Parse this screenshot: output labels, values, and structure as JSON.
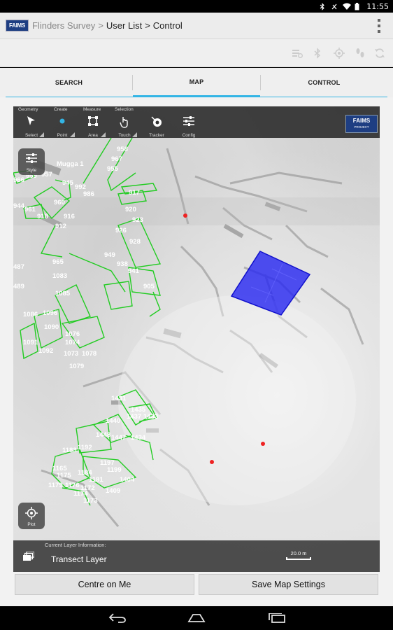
{
  "status_bar": {
    "icons": [
      "bluetooth-icon",
      "signal-off-icon",
      "wifi-icon",
      "battery-icon"
    ],
    "time": "11:55"
  },
  "action_bar": {
    "logo_text": "FAIMS",
    "breadcrumb": [
      "Flinders Survey",
      ">",
      "User List",
      ">",
      "Control"
    ],
    "overflow_icon": "overflow-menu-icon"
  },
  "tool_row": {
    "icons": [
      "sync-status-icon",
      "bluetooth-icon",
      "gps-icon",
      "tracker-icon",
      "sync-icon"
    ]
  },
  "tabs": [
    {
      "label": "SEARCH",
      "active": false
    },
    {
      "label": "MAP",
      "active": true
    },
    {
      "label": "CONTROL",
      "active": false
    }
  ],
  "map": {
    "toolbar": {
      "groups": [
        "Geometry",
        "Create",
        "Measure",
        "Selection"
      ],
      "buttons": [
        {
          "label": "Select",
          "icon": "cursor-icon"
        },
        {
          "label": "Point",
          "icon": "point-icon"
        },
        {
          "label": "Area",
          "icon": "polygon-icon"
        },
        {
          "label": "Touch",
          "icon": "touch-icon"
        },
        {
          "label": "Tracker",
          "icon": "tracker-icon"
        },
        {
          "label": "Config",
          "icon": "sliders-icon"
        }
      ],
      "badge": {
        "title": "FAIMS",
        "subtitle": "PROJECT"
      }
    },
    "style_button": {
      "label": "Style",
      "icon": "sliders-icon"
    },
    "plot_button": {
      "label": "Plot",
      "icon": "crosshair-icon"
    },
    "site_label": "Mugga 1",
    "feature_labels": [
      "958",
      "967",
      "955",
      "966",
      "959",
      "957",
      "945",
      "992",
      "986",
      "944",
      "961",
      "960",
      "918",
      "916",
      "912",
      "917",
      "920",
      "923",
      "926",
      "928",
      "949",
      "965",
      "938",
      "941",
      "905",
      "487",
      "489",
      "1083",
      "1085",
      "1086",
      "1096",
      "1090",
      "1091",
      "1092",
      "1076",
      "1074",
      "1073",
      "1078",
      "1079",
      "1431",
      "1435",
      "1437",
      "1433",
      "1440",
      "1448",
      "1447",
      "1434",
      "1197",
      "1199",
      "1183",
      "1192",
      "1404",
      "1409",
      "1172",
      "1173",
      "1175",
      "1179",
      "1184",
      "1181",
      "1174",
      "1165",
      "1176"
    ],
    "layer_bar": {
      "info_label": "Current Layer Information:",
      "layer_name": "Transect Layer",
      "scale_label": "20.0 m"
    },
    "selection_color": "#2222ff",
    "feature_color": "#22cc22",
    "point_color": "#ee2222"
  },
  "buttons": {
    "centre": "Centre on Me",
    "save": "Save Map Settings"
  },
  "nav_bar": {
    "icons": [
      "back-icon",
      "home-icon",
      "recent-apps-icon"
    ]
  },
  "colors": {
    "accent": "#33b5e5",
    "brand": "#1e3e82"
  }
}
